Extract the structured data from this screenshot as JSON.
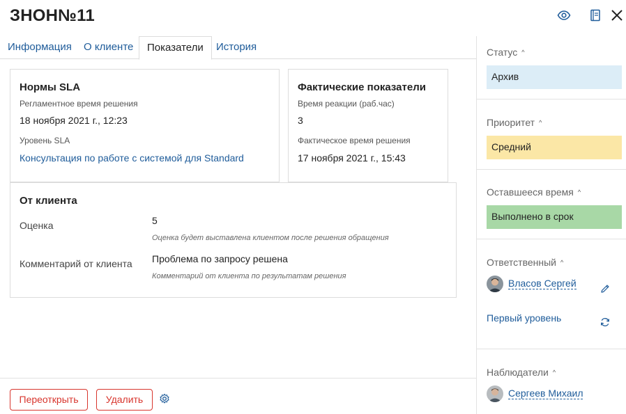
{
  "header": {
    "title": "ЗНОН№11",
    "icons": [
      "eye-icon",
      "book-icon",
      "close-icon"
    ]
  },
  "tabs": [
    {
      "label": "Информация",
      "active": false
    },
    {
      "label": "О клиенте",
      "active": false
    },
    {
      "label": "Показатели",
      "active": true
    },
    {
      "label": "История",
      "active": false
    }
  ],
  "sla": {
    "title": "Нормы SLA",
    "regulated_time_label": "Регламентное время решения",
    "regulated_time_value": "18 ноября 2021 г., 12:23",
    "level_label": "Уровень SLA",
    "level_value": "Консультация по работе с системой для Standard"
  },
  "actual": {
    "title": "Фактические показатели",
    "reaction_label": "Время реакции (раб.час)",
    "reaction_value": "3",
    "resolution_label": "Фактическое время решения",
    "resolution_value": "17 ноября 2021 г., 15:43"
  },
  "client": {
    "title": "От клиента",
    "rating_label": "Оценка",
    "rating_value": "5",
    "rating_hint": "Оценка будет выставлена клиентом после решения обращения",
    "comment_label": "Комментарий от клиента",
    "comment_value": "Проблема по запросу решена",
    "comment_hint": "Комментарий от клиента по результатам решения"
  },
  "footer": {
    "reopen_label": "Переоткрыть",
    "delete_label": "Удалить",
    "settings_icon": "gear-icon"
  },
  "sidebar": {
    "status": {
      "title": "Статус",
      "value": "Архив",
      "color": "#dcedf7"
    },
    "priority": {
      "title": "Приоритет",
      "value": "Средний",
      "color": "#fbe7a6"
    },
    "remaining": {
      "title": "Оставшееся время",
      "value": "Выполнено в срок",
      "color": "#a8d8a6"
    },
    "responsible": {
      "title": "Ответственный",
      "person": "Власов Сергей",
      "group": "Первый уровень",
      "edit_icon": "pencil-icon",
      "refresh_icon": "refresh-icon"
    },
    "observers": {
      "title": "Наблюдатели",
      "person": "Сергеев Михаил"
    }
  },
  "colors": {
    "accent_link": "#1f5c9a",
    "danger": "#d8352d",
    "border": "#dcdcdc"
  }
}
